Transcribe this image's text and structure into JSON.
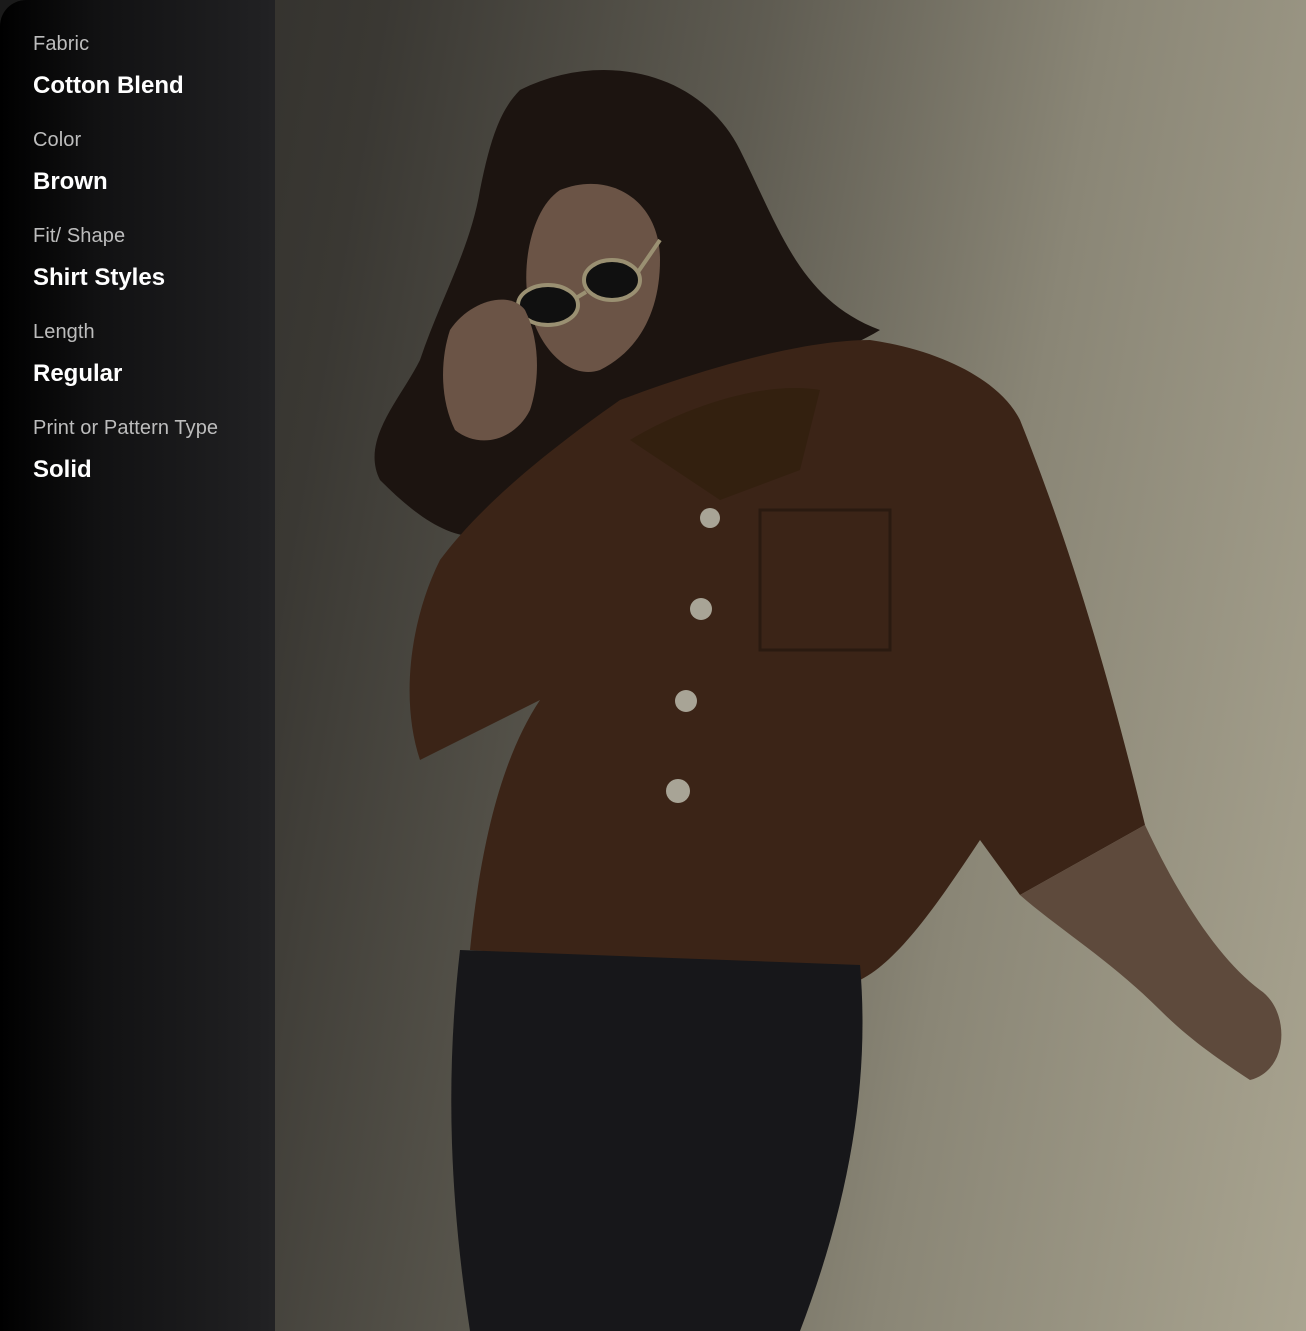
{
  "attributes": [
    {
      "label": "Fabric",
      "value": "Cotton Blend"
    },
    {
      "label": "Color",
      "value": "Brown"
    },
    {
      "label": "Fit/ Shape",
      "value": "Shirt Styles"
    },
    {
      "label": "Length",
      "value": "Regular"
    },
    {
      "label": "Print or Pattern Type",
      "value": "Solid"
    }
  ],
  "colors": {
    "panel_bg": "#000000",
    "label": "#bdbdbd",
    "value": "#ffffff",
    "shirt": "#3b2417"
  }
}
